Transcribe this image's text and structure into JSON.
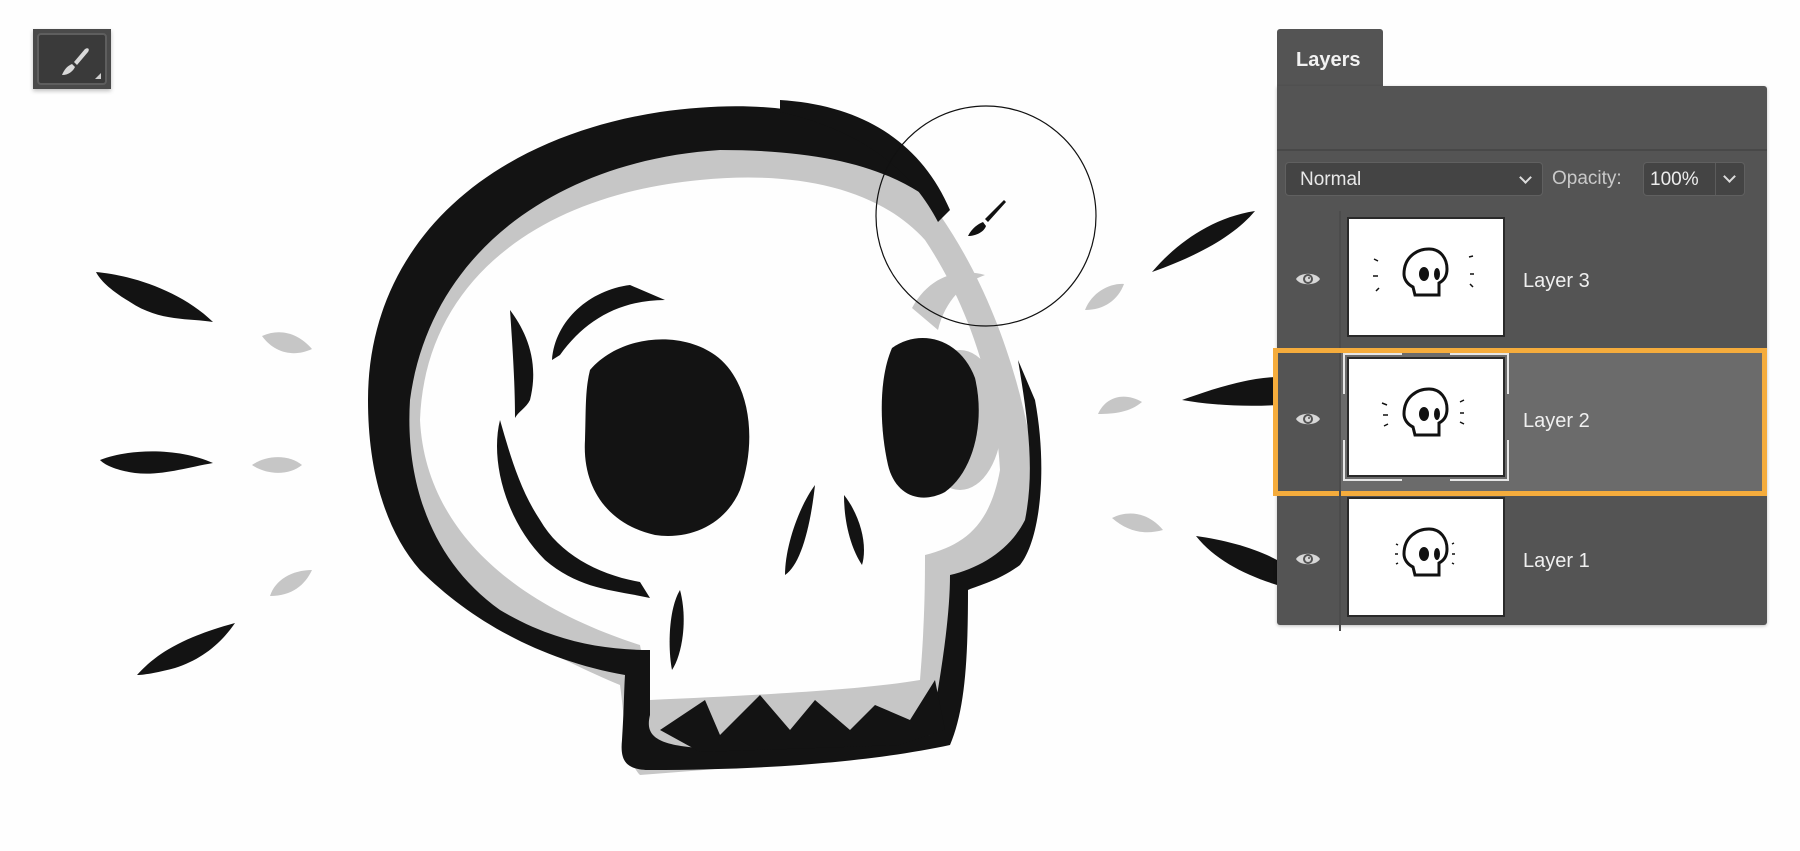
{
  "toolbar": {
    "active_tool": {
      "name": "Brush Tool",
      "icon": "brush-icon"
    }
  },
  "canvas": {
    "subject": "skull illustration",
    "colors": {
      "ink": "#131313",
      "ghost": "#c6c6c6",
      "background": "#fefefe"
    },
    "cursor": {
      "icon": "brush-cursor-icon"
    }
  },
  "layers_panel": {
    "tab_label": "Layers",
    "blend_mode": "Normal",
    "opacity_label": "Opacity:",
    "opacity_value": "100%",
    "highlight_color": "#f5ac3c",
    "layers": [
      {
        "name": "Layer 3",
        "visible": true,
        "selected": false,
        "eye_icon": "eye-icon"
      },
      {
        "name": "Layer 2",
        "visible": true,
        "selected": true,
        "eye_icon": "eye-icon"
      },
      {
        "name": "Layer 1",
        "visible": true,
        "selected": false,
        "eye_icon": "eye-icon"
      }
    ]
  }
}
